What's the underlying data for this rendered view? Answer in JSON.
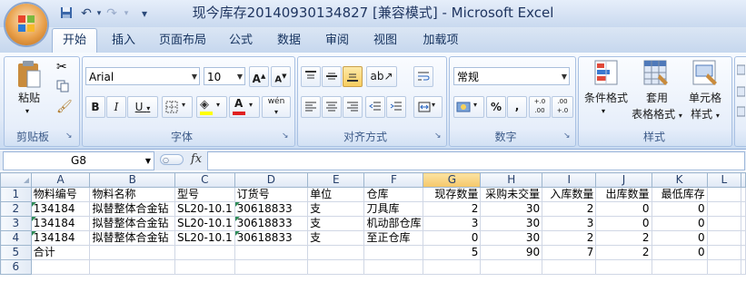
{
  "window": {
    "title": "现今库存20140930134827  [兼容模式] - Microsoft Excel"
  },
  "quick_access": {
    "save_icon": "save-icon",
    "undo_label": "↶",
    "redo_label": "↷",
    "more_label": "▾"
  },
  "tabs": [
    "开始",
    "插入",
    "页面布局",
    "公式",
    "数据",
    "审阅",
    "视图",
    "加载项"
  ],
  "ribbon": {
    "clipboard": {
      "label": "剪贴板",
      "paste": "粘贴"
    },
    "font": {
      "label": "字体",
      "family": "Arial",
      "size": "10",
      "grow": "A",
      "shrink": "A",
      "bold": "B",
      "italic": "I",
      "underline": "U",
      "font_color": "A",
      "phonetic": "wén"
    },
    "alignment": {
      "label": "对齐方式"
    },
    "number": {
      "label": "数字",
      "format": "常规",
      "percent": "%",
      "comma": ",",
      "inc_dec": "+.0 .00",
      "dec_dec": ".00 +.0"
    },
    "styles": {
      "label": "样式",
      "cond_format": "条件格式",
      "table_format_1": "套用",
      "table_format_2": "表格格式",
      "cell_style_1": "单元格",
      "cell_style_2": "样式"
    }
  },
  "formula_bar": {
    "name_box": "G8",
    "fx": "fx",
    "value": ""
  },
  "sheet": {
    "columns": [
      "A",
      "B",
      "C",
      "D",
      "E",
      "F",
      "G",
      "H",
      "I",
      "J",
      "K",
      "L"
    ],
    "selected_column": "G",
    "rows": [
      {
        "num": "1",
        "cells": [
          "物料编号",
          "物料名称",
          "型号",
          "订货号",
          "单位",
          "仓库",
          "现存数量",
          "采购未交量",
          "入库数量",
          "出库数量",
          "最低库存",
          ""
        ]
      },
      {
        "num": "2",
        "cells": [
          "134184",
          "拟替整体合金钻",
          "SL20-10.1",
          "30618833",
          "支",
          "刀具库",
          "2",
          "30",
          "2",
          "0",
          "0",
          ""
        ]
      },
      {
        "num": "3",
        "cells": [
          "134184",
          "拟替整体合金钻",
          "SL20-10.1",
          "30618833",
          "支",
          "机动部仓库",
          "3",
          "30",
          "3",
          "0",
          "0",
          ""
        ]
      },
      {
        "num": "4",
        "cells": [
          "134184",
          "拟替整体合金钻",
          "SL20-10.1",
          "30618833",
          "支",
          "至正仓库",
          "0",
          "30",
          "2",
          "2",
          "0",
          ""
        ]
      },
      {
        "num": "5",
        "cells": [
          "合计",
          "",
          "",
          "",
          "",
          "",
          "5",
          "90",
          "7",
          "2",
          "0",
          ""
        ]
      },
      {
        "num": "6",
        "cells": [
          "",
          "",
          "",
          "",
          "",
          "",
          "",
          "",
          "",
          "",
          "",
          ""
        ]
      }
    ]
  }
}
